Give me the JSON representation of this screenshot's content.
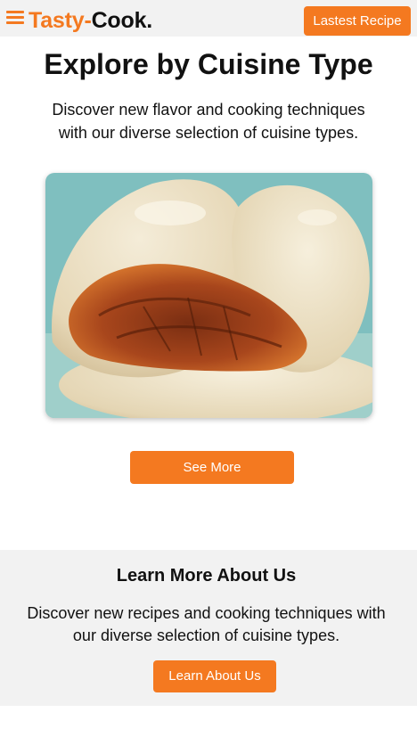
{
  "header": {
    "brand_part1": "Tasty-",
    "brand_part2": "Cook.",
    "latest_button": "Lastest Recipe",
    "menu_icon": "hamburger-menu-icon"
  },
  "hero": {
    "title": "Explore by Cuisine Type",
    "description": "Discover new flavor and cooking techniques with our diverse selection of cuisine types.",
    "image_subject": "steamed bun with pork filling",
    "see_more_button": "See More"
  },
  "about": {
    "title": "Learn More About Us",
    "description": "Discover new recipes and cooking techniques with our diverse selection of cuisine types.",
    "button": "Learn About Us"
  },
  "colors": {
    "accent": "#f47920",
    "header_bg": "#f2f2f2",
    "text": "#111111"
  }
}
